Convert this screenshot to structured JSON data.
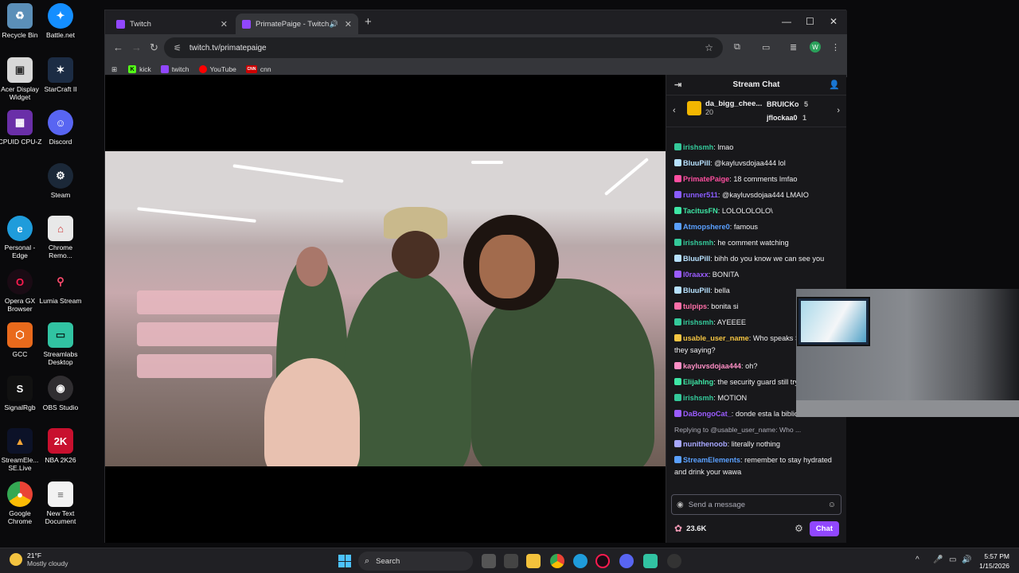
{
  "desktop": {
    "icons": [
      {
        "label": "Recycle Bin"
      },
      {
        "label": "Battle.net"
      },
      {
        "label": "Acer Display Widget"
      },
      {
        "label": "StarCraft II"
      },
      {
        "label": "CPUID CPU-Z"
      },
      {
        "label": "Discord"
      },
      {
        "label": "Steam"
      },
      {
        "label": "Personal - Edge"
      },
      {
        "label": "Chrome Remo..."
      },
      {
        "label": "Opera GX Browser"
      },
      {
        "label": "Lumia Stream"
      },
      {
        "label": "GCC"
      },
      {
        "label": "Streamlabs Desktop"
      },
      {
        "label": "SignalRgb"
      },
      {
        "label": "OBS Studio"
      },
      {
        "label": "StreamEle... SE.Live"
      },
      {
        "label": "NBA 2K26"
      },
      {
        "label": "Google Chrome"
      },
      {
        "label": "New Text Document"
      }
    ]
  },
  "browser": {
    "tabs": [
      {
        "title": "Twitch"
      },
      {
        "title": "PrimatePaige - Twitch"
      }
    ],
    "url": "twitch.tv/primatepaige",
    "profile_initial": "W",
    "bookmarks": [
      {
        "label": "kick",
        "abbr": "K",
        "color": "#53fc18"
      },
      {
        "label": "twitch",
        "abbr": "",
        "color": "#9147ff"
      },
      {
        "label": "YouTube",
        "abbr": "",
        "color": "#ff0000"
      },
      {
        "label": "cnn",
        "abbr": "CNN",
        "color": "#cc0000"
      }
    ]
  },
  "chat": {
    "title": "Stream Chat",
    "gift_leader": {
      "name": "da_bigg_chee...",
      "count": "20"
    },
    "gift_side": [
      {
        "name": "BRUICKo",
        "count": "5"
      },
      {
        "name": "jflockaa0",
        "count": "1"
      }
    ],
    "messages": [
      {
        "user": "irishsmh",
        "color": "#34c99a",
        "text": ": lmao"
      },
      {
        "user": "BluuPill",
        "color": "#b7e1ff",
        "text": ": @kayluvsdojaa444 lol"
      },
      {
        "user": "PrimatePaige",
        "color": "#ff4fa0",
        "text": ": 18 comments lmfao"
      },
      {
        "user": "runner511",
        "color": "#8a5cff",
        "text": ": @kayluvsdojaa444 LMAIO"
      },
      {
        "user": "TacitusFN",
        "color": "#3ee6a5",
        "text": ": LOLOLOLOLO\\"
      },
      {
        "user": "Atmopshere0",
        "color": "#5aa0ff",
        "text": ": famous"
      },
      {
        "user": "irishsmh",
        "color": "#34c99a",
        "text": ": he comment watching"
      },
      {
        "user": "BluuPill",
        "color": "#b7e1ff",
        "text": ": bihh do you know we can see you"
      },
      {
        "user": "l0raaxx",
        "color": "#9b5cff",
        "text": ": BONITA"
      },
      {
        "user": "BluuPill",
        "color": "#b7e1ff",
        "text": ": bella"
      },
      {
        "user": "tulpips",
        "color": "#ff6fa8",
        "text": ": bonita si"
      },
      {
        "user": "irishsmh",
        "color": "#34c99a",
        "text": ": AYEEEE"
      },
      {
        "user": "usable_user_name",
        "color": "#f5c542",
        "text": ": Who speaks S... What are they saying?"
      },
      {
        "user": "kayluvsdojaa444",
        "color": "#ff8fc6",
        "text": ": oh?"
      },
      {
        "user": "Elijahlng",
        "color": "#3ee6a5",
        "text": ": the security guard still try... find them"
      },
      {
        "user": "irishsmh",
        "color": "#34c99a",
        "text": ": MOTION"
      },
      {
        "user": "DaBongoCat_",
        "color": "#9b5cff",
        "text": ": donde esta la biblioteca"
      }
    ],
    "reply_hint": "Replying to @usable_user_name: Who ...",
    "tail_messages": [
      {
        "user": "nunithenoob",
        "color": "#a7a7ff",
        "text": ": literally nothing"
      },
      {
        "user": "StreamElements",
        "color": "#5aa0ff",
        "text": ": remember to stay hydrated and drink your wawa"
      }
    ],
    "placeholder": "Send a message",
    "points": "23.6K",
    "chat_button": "Chat"
  },
  "taskbar": {
    "temperature": "21°F",
    "weather": "Mostly cloudy",
    "search": "Search",
    "time": "5:57 PM",
    "date": "1/15/2026"
  }
}
